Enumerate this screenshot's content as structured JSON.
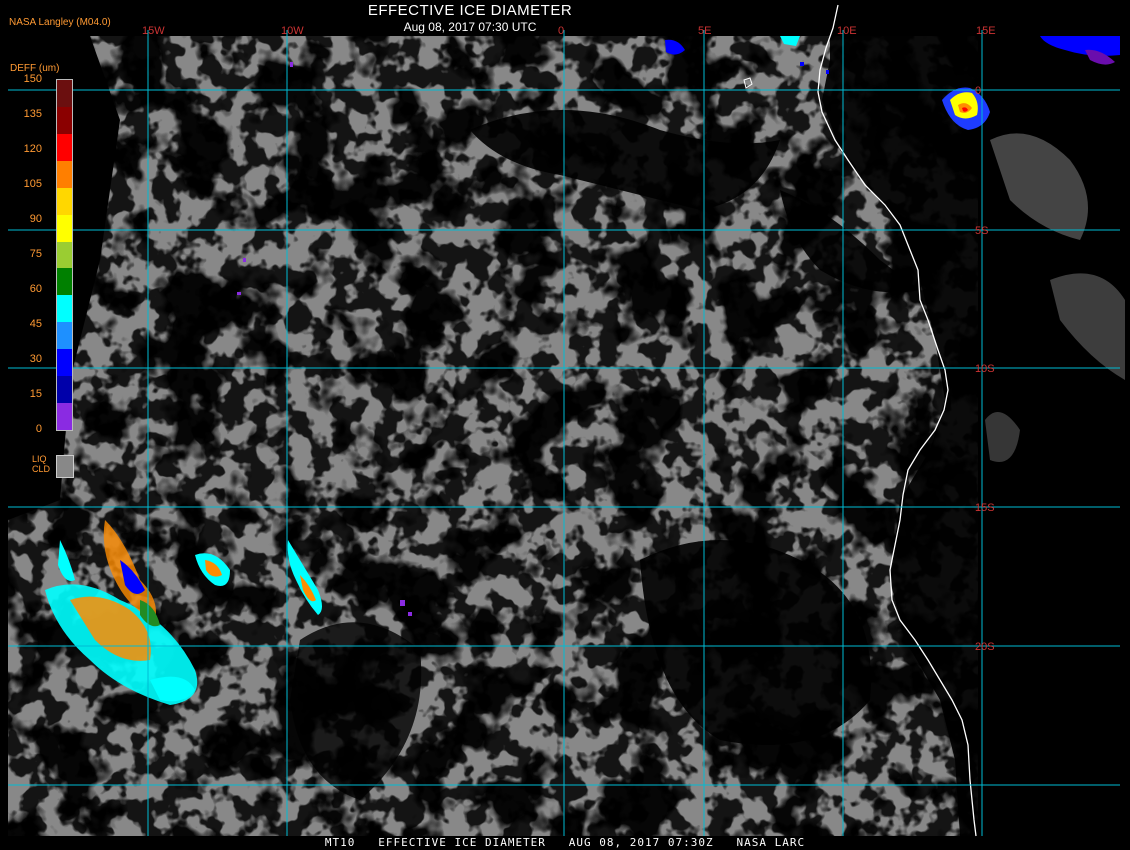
{
  "header": {
    "title": "EFFECTIVE ICE DIAMETER",
    "subtitle": "Aug 08, 2017 07:30 UTC",
    "source": "NASA Langley (M04.0)"
  },
  "legend": {
    "title": "DEFF (um)",
    "ticks": [
      "150",
      "135",
      "120",
      "105",
      "90",
      "75",
      "60",
      "45",
      "30",
      "15",
      "0"
    ],
    "colors": [
      "#6b0f0f",
      "#8b0000",
      "#ff0000",
      "#ff7f00",
      "#ffd700",
      "#ffff00",
      "#9acd32",
      "#008000",
      "#00ffff",
      "#1e90ff",
      "#0000ff",
      "#0000aa",
      "#8a2be2"
    ],
    "liquid_label_1": "LIQ",
    "liquid_label_2": "CLD",
    "liquid_color": "#888888"
  },
  "grid": {
    "longitudes": [
      "15W",
      "10W",
      "0",
      "5E",
      "10E",
      "15E"
    ],
    "latitudes": [
      "0",
      "5S",
      "10S",
      "15S",
      "20S"
    ],
    "line_color": "#00bcd4"
  },
  "colors": {
    "liquid_cloud": "#888888",
    "clear": "#000000",
    "coastline": "#ffffff"
  },
  "footer": {
    "text": "MT10   EFFECTIVE ICE DIAMETER   AUG 08, 2017 07:30Z   NASA LARC"
  }
}
